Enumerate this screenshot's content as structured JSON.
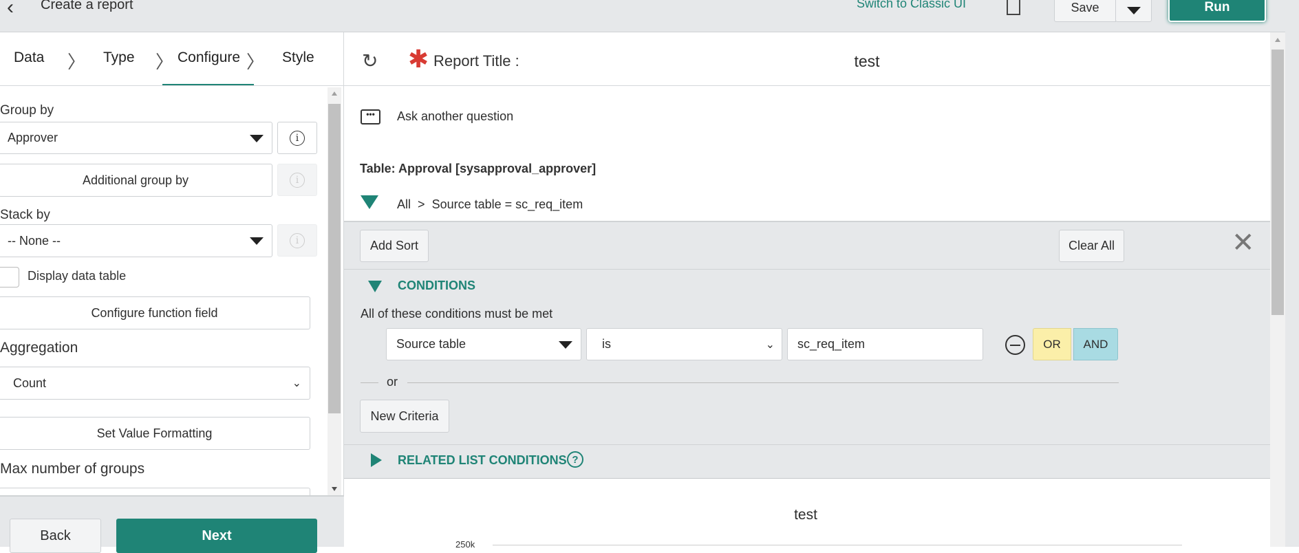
{
  "header": {
    "title": "Create a report",
    "switch_label": "Switch to Classic UI",
    "save_label": "Save",
    "run_label": "Run"
  },
  "steps": [
    {
      "label": "Data"
    },
    {
      "label": "Type"
    },
    {
      "label": "Configure",
      "active": true
    },
    {
      "label": "Style"
    }
  ],
  "config": {
    "group_by_label": "Group by",
    "group_by_value": "Approver",
    "additional_group_by": "Additional group by",
    "stack_by_label": "Stack by",
    "stack_by_value": "-- None --",
    "display_data_table": "Display data table",
    "display_data_table_checked": false,
    "configure_function_field": "Configure function field",
    "aggregation_label": "Aggregation",
    "aggregation_value": "Count",
    "set_value_formatting": "Set Value Formatting",
    "max_groups_label": "Max number of groups"
  },
  "footer": {
    "back": "Back",
    "next": "Next"
  },
  "report": {
    "title_label": "Report Title :",
    "title_value": "test",
    "ask": "Ask another question",
    "table": "Table: Approval [sysapproval_approver]",
    "breadcrumb_all": "All",
    "breadcrumb_sep": ">",
    "breadcrumb_condition": "Source table = sc_req_item"
  },
  "filter": {
    "add_sort": "Add Sort",
    "clear_all": "Clear All",
    "conditions_heading": "CONDITIONS",
    "all_met": "All of these conditions must be met",
    "condition": {
      "field": "Source table",
      "operator": "is",
      "value": "sc_req_item"
    },
    "or_label": "OR",
    "and_label": "AND",
    "or_divider": "or",
    "new_criteria": "New Criteria",
    "related_list": "RELATED LIST CONDITIONS"
  },
  "chart": {
    "title": "test",
    "y_tick_top": "250k"
  },
  "colors": {
    "accent": "#1f8476",
    "or_bg": "#fbefa9",
    "and_bg": "#a9dbe3",
    "required": "#d83b33"
  }
}
